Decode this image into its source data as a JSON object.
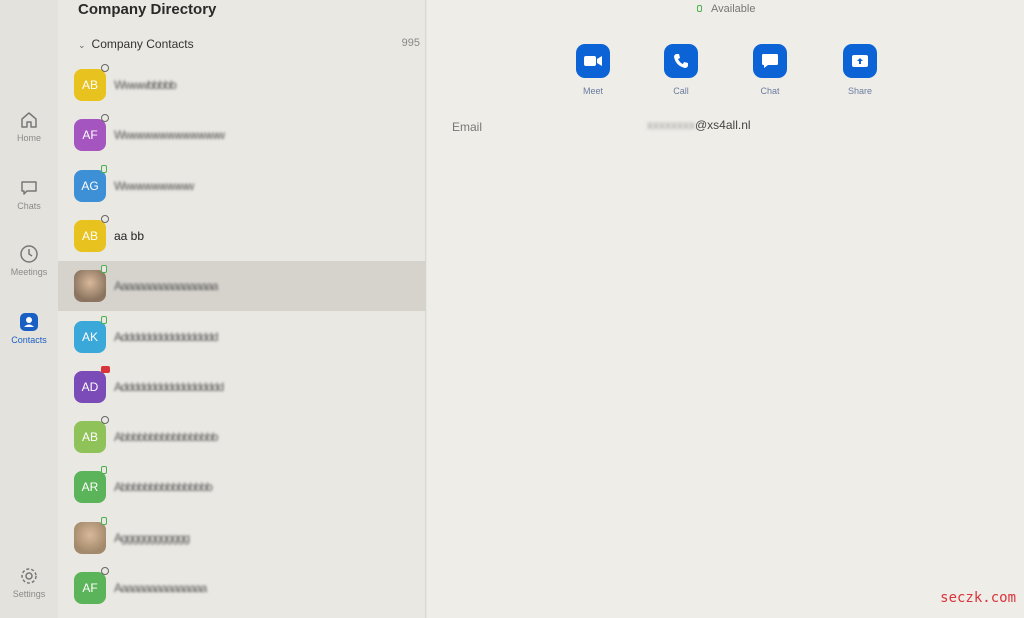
{
  "nav": [
    {
      "label": "Home",
      "icon": "home-icon"
    },
    {
      "label": "Chats",
      "icon": "chat-bubble-icon"
    },
    {
      "label": "Meetings",
      "icon": "clock-icon"
    },
    {
      "label": "Contacts",
      "icon": "contact-icon",
      "active": true
    },
    {
      "label": "Settings",
      "icon": "gear-icon"
    }
  ],
  "list": {
    "title": "Company Directory",
    "group": {
      "label": "Company Contacts",
      "count": "995"
    },
    "contacts": [
      {
        "initials": "AB",
        "color": "#e8c21e",
        "status": "away",
        "name": "Wwwwbbbbb"
      },
      {
        "initials": "AF",
        "color": "#a455c0",
        "status": "away",
        "name": "Wwwwwwwwwwwwww"
      },
      {
        "initials": "AG",
        "color": "#3d8fd6",
        "status": "available",
        "name": "Wwwwwwwwww"
      },
      {
        "initials": "AB",
        "color": "#e8c21e",
        "status": "away",
        "name": "aa bb"
      },
      {
        "initials": "",
        "color": "#8b7560",
        "status": "available",
        "name": "Aaaaaaaaaaaaaaaaaa",
        "photo": true,
        "selected": true
      },
      {
        "initials": "AK",
        "color": "#3aa9d9",
        "status": "available",
        "name": "Addddddddddddddddd"
      },
      {
        "initials": "AD",
        "color": "#7b4bb7",
        "status": "in-meeting",
        "name": "Adddddddddddddddddd"
      },
      {
        "initials": "AB",
        "color": "#8fc259",
        "status": "away",
        "name": "Abbbbbbbbbbbbbbbbb"
      },
      {
        "initials": "AR",
        "color": "#5bb35a",
        "status": "available",
        "name": "Abbbbbbbbbbbbbbbb"
      },
      {
        "initials": "",
        "color": "#a48a6c",
        "status": "available",
        "name": "Agggggggggggg",
        "photo": true
      },
      {
        "initials": "AF",
        "color": "#5bb35a",
        "status": "away",
        "name": "Aaaaaaaaaaaaaaaa"
      }
    ]
  },
  "detail": {
    "status": "Available",
    "actions": [
      {
        "label": "Meet",
        "icon": "video-camera-icon"
      },
      {
        "label": "Call",
        "icon": "phone-icon"
      },
      {
        "label": "Chat",
        "icon": "chat-bubble-icon"
      },
      {
        "label": "Share",
        "icon": "share-screen-icon"
      }
    ],
    "email_label": "Email",
    "email_hidden": "xxxxxxxx",
    "email_visible": "@xs4all.nl"
  },
  "watermark": "seczk.com",
  "colors": {
    "accent": "#0b63d6",
    "available": "#4caf50",
    "in_meeting": "#d9343a"
  }
}
